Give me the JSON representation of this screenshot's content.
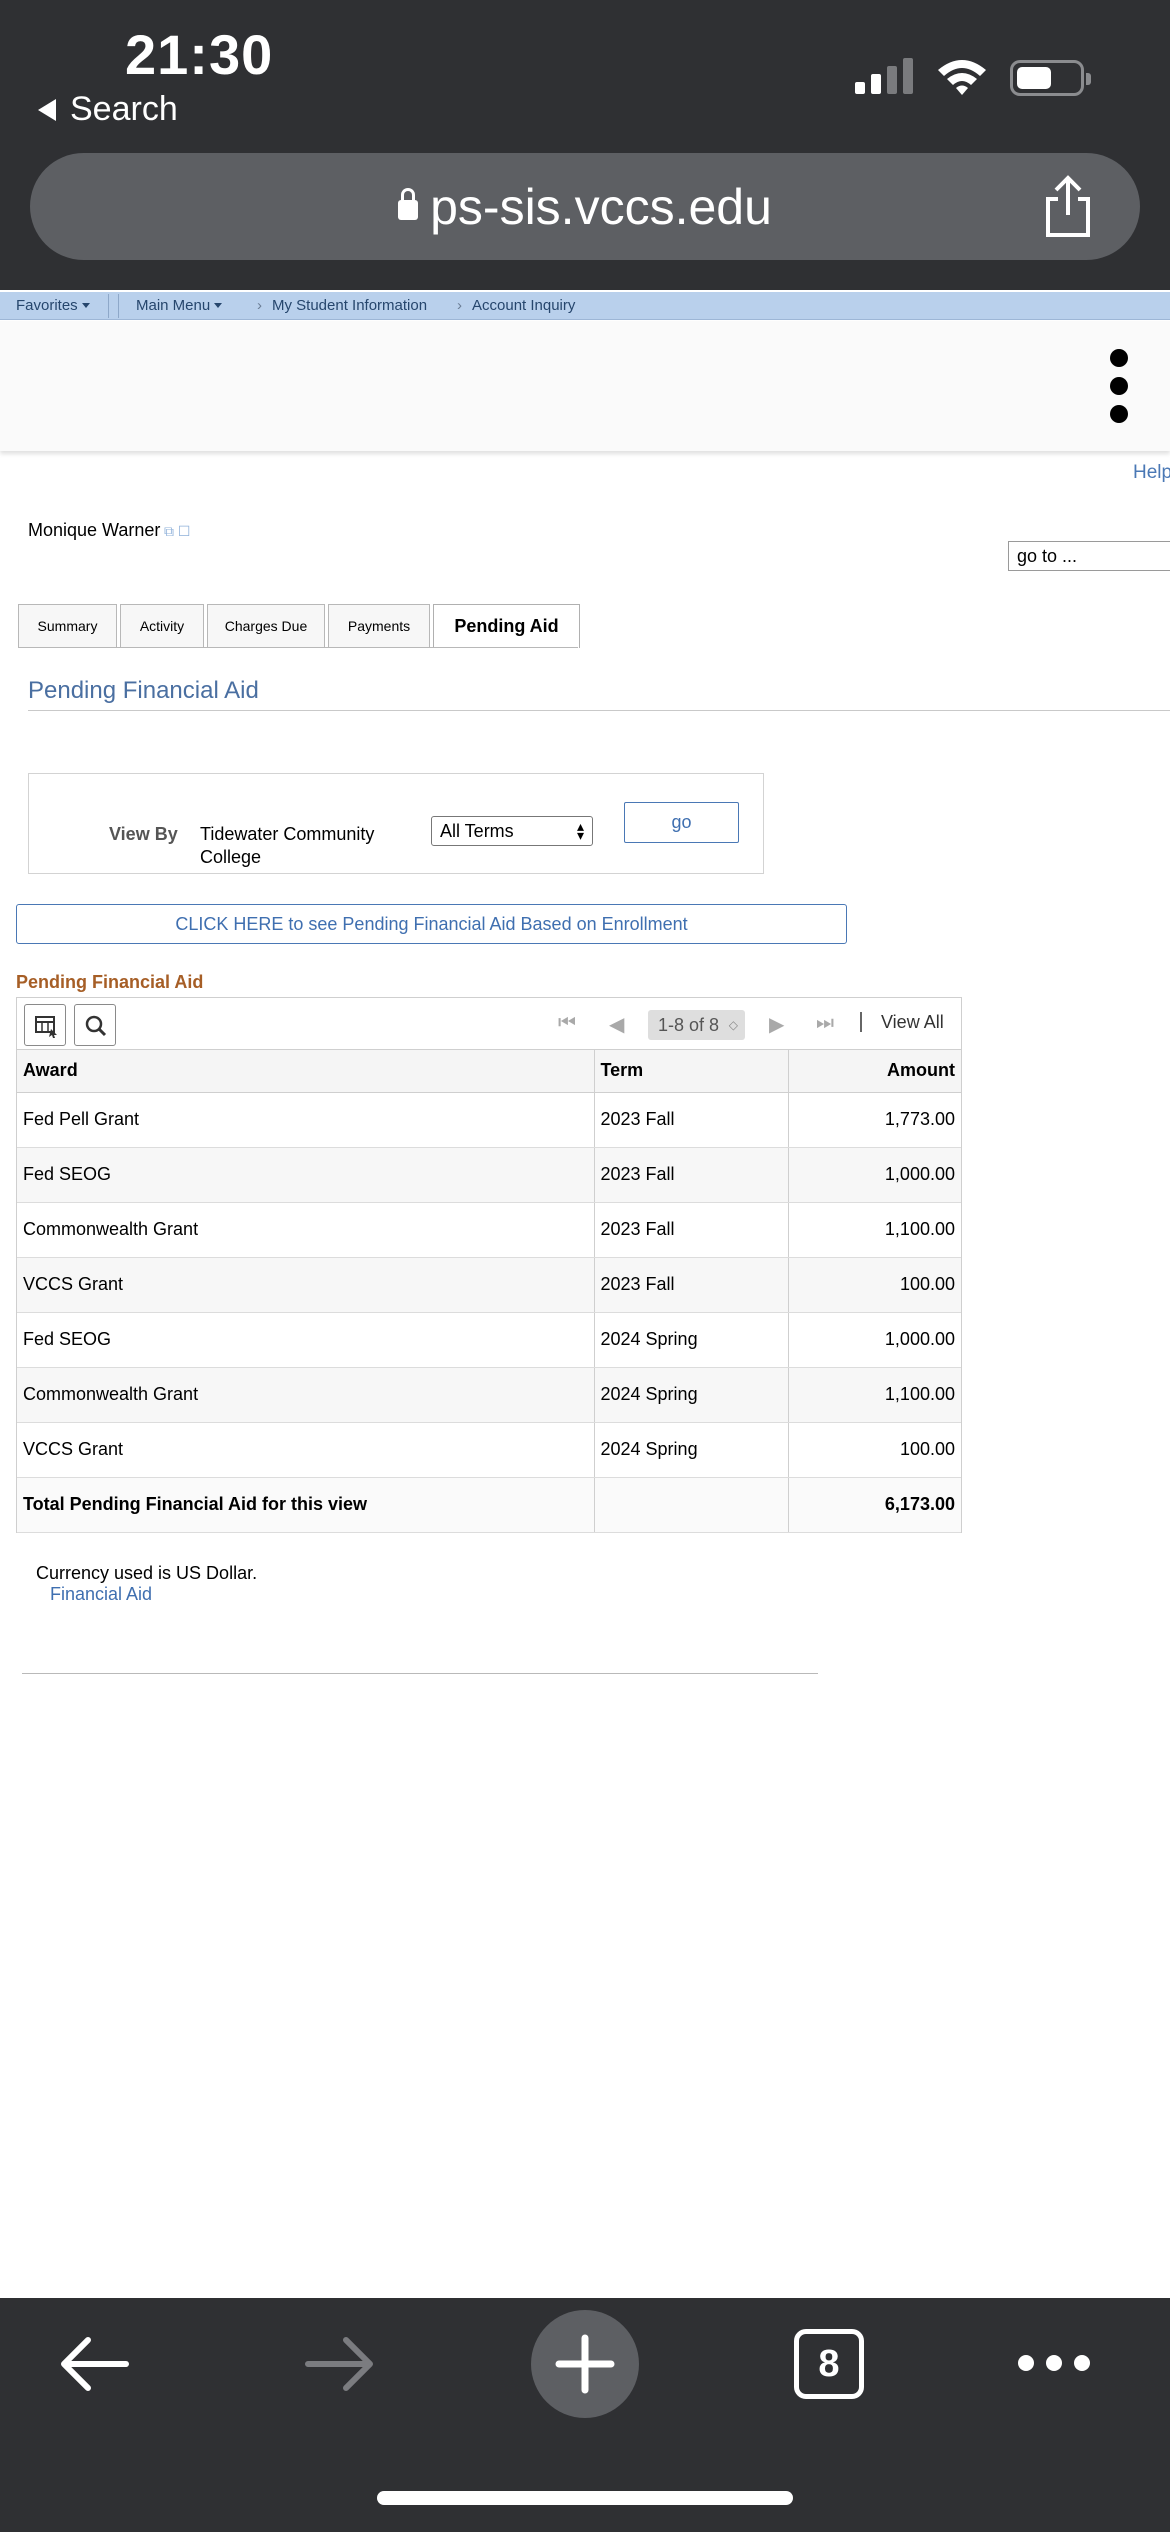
{
  "status_bar": {
    "time": "21:30",
    "back_label": "Search"
  },
  "browser": {
    "url": "ps-sis.vccs.edu",
    "tab_count": "8"
  },
  "breadcrumb": {
    "favorites": "Favorites",
    "main_menu": "Main Menu",
    "my_student_info": "My Student Information",
    "account_inquiry": "Account Inquiry"
  },
  "header": {
    "help": "Help",
    "goto": "go to ..."
  },
  "student": {
    "name": "Monique Warner"
  },
  "tabs": [
    {
      "label": "Summary"
    },
    {
      "label": "Activity"
    },
    {
      "label": "Charges Due"
    },
    {
      "label": "Payments"
    },
    {
      "label": "Pending Aid"
    }
  ],
  "page_title": "Pending Financial Aid",
  "view_by": {
    "label": "View By",
    "college": "Tidewater Community College",
    "term_selected": "All Terms",
    "go_label": "go"
  },
  "enrollment_button": "CLICK HERE to see Pending Financial Aid Based on Enrollment",
  "grid": {
    "title": "Pending Financial Aid",
    "page_count": "1-8 of 8",
    "view_all": "View All",
    "columns": {
      "award": "Award",
      "term": "Term",
      "amount": "Amount"
    },
    "rows": [
      {
        "award": "Fed Pell Grant",
        "term": "2023 Fall",
        "amount": "1,773.00"
      },
      {
        "award": "Fed SEOG",
        "term": "2023 Fall",
        "amount": "1,000.00"
      },
      {
        "award": "Commonwealth Grant",
        "term": "2023 Fall",
        "amount": "1,100.00"
      },
      {
        "award": "VCCS Grant",
        "term": "2023 Fall",
        "amount": "100.00"
      },
      {
        "award": "Fed SEOG",
        "term": "2024 Spring",
        "amount": "1,000.00"
      },
      {
        "award": "Commonwealth Grant",
        "term": "2024 Spring",
        "amount": "1,100.00"
      },
      {
        "award": "VCCS Grant",
        "term": "2024 Spring",
        "amount": "100.00"
      }
    ],
    "total": {
      "label": "Total Pending Financial Aid for this view",
      "amount": "6,173.00"
    }
  },
  "footer": {
    "currency_note": "Currency used is US Dollar.",
    "financial_aid_link": "Financial Aid"
  },
  "icons": {
    "back": "back-arrow-icon",
    "forward": "forward-arrow-icon",
    "new_tab": "plus-icon",
    "tabs": "tabs-icon",
    "more": "more-icon",
    "share": "share-icon",
    "lock": "lock-icon"
  },
  "colors": {
    "link_blue": "#3f6fb0",
    "grid_title": "#a65e26",
    "crumb_bg": "#b9d0ec",
    "chrome": "#2f3033"
  }
}
